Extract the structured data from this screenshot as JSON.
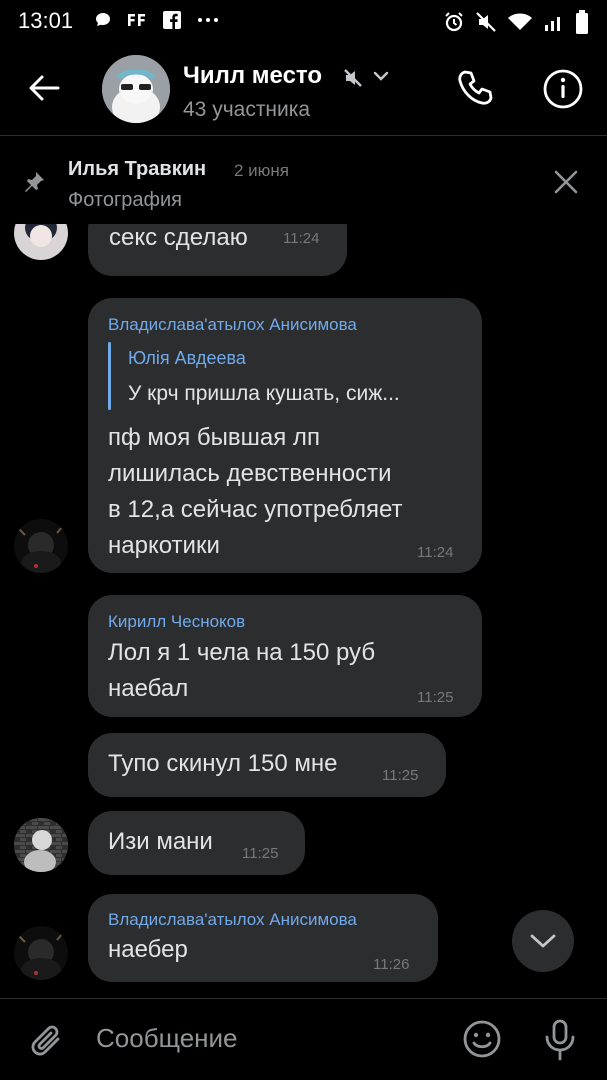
{
  "status_bar": {
    "time": "13:01"
  },
  "header": {
    "title": "Чилл место",
    "subtitle": "43 участника"
  },
  "pinned": {
    "author": "Илья Травкин",
    "date": "2 июня",
    "text": "Фотография"
  },
  "messages": [
    {
      "text": "секс сделаю",
      "time": "11:24"
    },
    {
      "author": "Владислава'атылох Анисимова",
      "reply_author": "Юлія Авдеева",
      "reply_text": "У крч пришла кушать, сиж...",
      "lines": [
        "пф моя бывшая лп",
        "лишилась девственности",
        "в 12,а сейчас употребляет",
        "наркотики"
      ],
      "time": "11:24"
    },
    {
      "author": "Кирилл Чесноков",
      "lines": [
        "Лол я 1 чела на 150 руб",
        "наебал"
      ],
      "time": "11:25"
    },
    {
      "text": "Тупо скинул 150 мне",
      "time": "11:25"
    },
    {
      "text": "Изи мани",
      "time": "11:25"
    },
    {
      "author": "Владислава'атылох Анисимова",
      "text": "наебер",
      "time": "11:26"
    }
  ],
  "composer": {
    "placeholder": "Сообщение"
  },
  "colors": {
    "accent": "#71aaeb",
    "bubble": "#2c2d2e",
    "background": "#000000"
  }
}
